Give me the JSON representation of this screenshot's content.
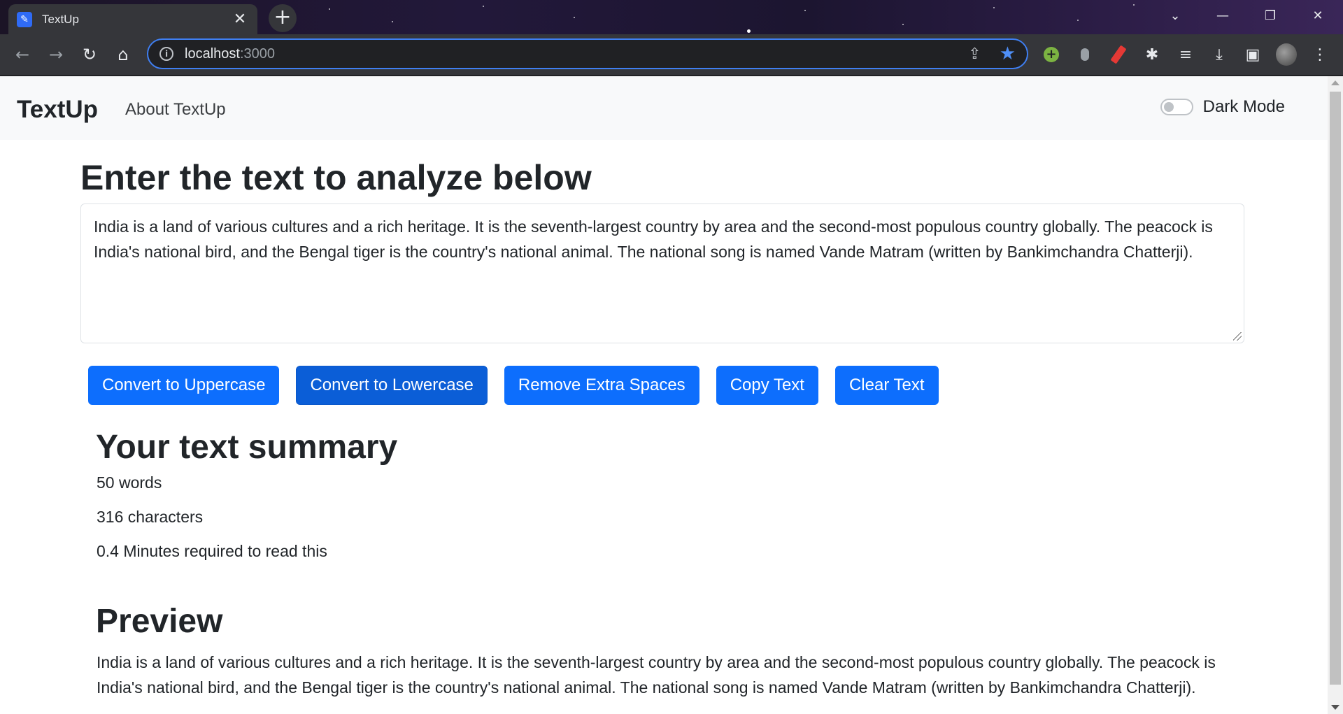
{
  "browser": {
    "tab_title": "TextUp",
    "tab_favicon_icon": "edit-note-icon",
    "close_glyph": "✕",
    "newtab_glyph": "+",
    "address_host": "localhost",
    "address_port": ":3000",
    "window_controls": [
      "⌄",
      "—",
      "❐",
      "✕"
    ],
    "nav_glyphs": {
      "back": "←",
      "forward": "→",
      "reload": "↻",
      "home": "⌂"
    },
    "omni_glyphs": {
      "info": "i",
      "share": "⇪",
      "bookmark": "★"
    },
    "ext_glyphs": {
      "green": "+",
      "puzzle": "✱",
      "media": "≡",
      "download": "⤓",
      "sidepanel": "▣",
      "menu": "⋮"
    },
    "icons": [
      "info-icon",
      "share-icon",
      "bookmark-star-icon",
      "extension-green-icon",
      "extension-mouse-icon",
      "extension-red-pen-icon",
      "puzzle-icon",
      "media-queue-icon",
      "download-icon",
      "side-panel-icon",
      "profile-avatar",
      "kebab-menu-icon"
    ]
  },
  "navbar": {
    "brand": "TextUp",
    "about_link": "About TextUp",
    "dark_mode_label": "Dark Mode",
    "dark_mode_on": false
  },
  "main": {
    "heading": "Enter the text to analyze below",
    "textarea_value": "India is a land of various cultures and a rich heritage. It is the seventh-largest country by area and the second-most populous country globally. The peacock is India's national bird, and the Bengal tiger is the country's national animal. The national song is named Vande Matram (written by Bankimchandra Chatterji).",
    "buttons": {
      "uppercase": "Convert to Uppercase",
      "lowercase": "Convert to Lowercase",
      "extra_spaces": "Remove Extra Spaces",
      "copy": "Copy Text",
      "clear": "Clear Text"
    }
  },
  "summary": {
    "title": "Your text summary",
    "words": "50 words",
    "characters": "316 characters",
    "read_time": "0.4 Minutes required to read this"
  },
  "preview": {
    "title": "Preview",
    "text": "India is a land of various cultures and a rich heritage. It is the seventh-largest country by area and the second-most populous country globally. The peacock is India's national bird, and the Bengal tiger is the country's national animal. The national song is named Vande Matram (written by Bankimchandra Chatterji)."
  },
  "colors": {
    "primary": "#0d6efd",
    "primary_active": "#0b5ed7",
    "navbar_bg": "#f8f9fa",
    "text": "#212529"
  }
}
